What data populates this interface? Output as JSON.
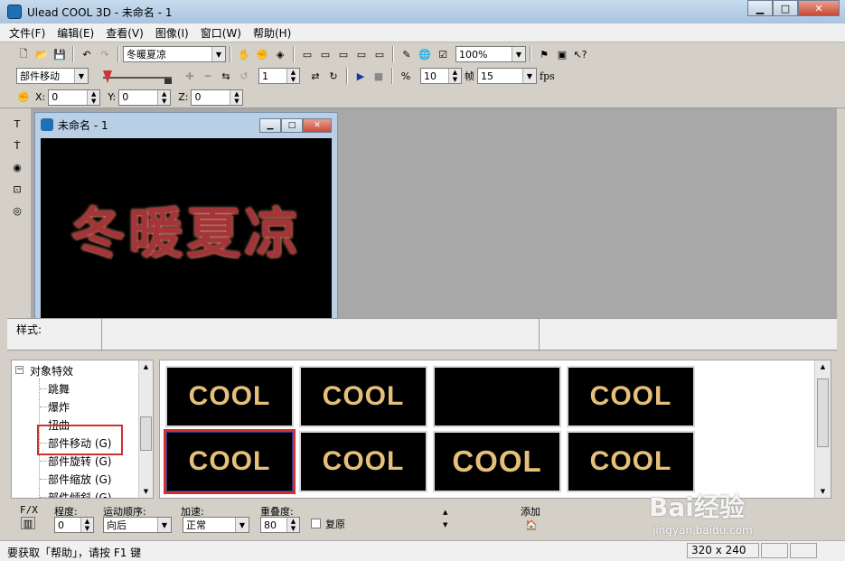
{
  "window": {
    "title": "Ulead COOL 3D - 未命名 - 1"
  },
  "menu": [
    "文件(F)",
    "编辑(E)",
    "查看(V)",
    "图像(I)",
    "窗口(W)",
    "帮助(H)"
  ],
  "toolbar": {
    "text_combo": "冬暖夏凉",
    "zoom": "100%",
    "effect_select": "部件移动",
    "frame": "1",
    "frames_total": "10",
    "frames_label": "帧",
    "fps_value": "15",
    "fps_label": "fps"
  },
  "coords": {
    "x_label": "X:",
    "x": "0",
    "y_label": "Y:",
    "y": "0",
    "z_label": "Z:",
    "z": "0"
  },
  "document": {
    "title": "未命名 - 1",
    "canvas_text": "冬暖夏凉"
  },
  "style_panel": {
    "label": "样式:"
  },
  "tree": {
    "root": "对象特效",
    "items": [
      "跳舞",
      "爆炸",
      "扭曲",
      "部件移动 (G)",
      "部件旋转 (G)",
      "部件缩放 (G)",
      "部件倾斜 (G)"
    ]
  },
  "gallery": {
    "tiles": [
      "COOL",
      "COOL",
      "",
      "COOL",
      "COOL",
      "COOL",
      "COOL",
      "COOL"
    ]
  },
  "props": {
    "fx_label": "F/X",
    "degree_label": "程度:",
    "degree_value": "0",
    "order_label": "运动顺序:",
    "order_value": "向后",
    "speed_label": "加速:",
    "speed_value": "正常",
    "overlap_label": "重叠度:",
    "overlap_value": "80",
    "restore_label": "复原",
    "add_label": "添加"
  },
  "status": {
    "message": "要获取「帮助」，请按 F1 键",
    "size": "320 x 240"
  },
  "watermark": {
    "brand": "Bai经验",
    "url": "jingyan.baidu.com"
  }
}
